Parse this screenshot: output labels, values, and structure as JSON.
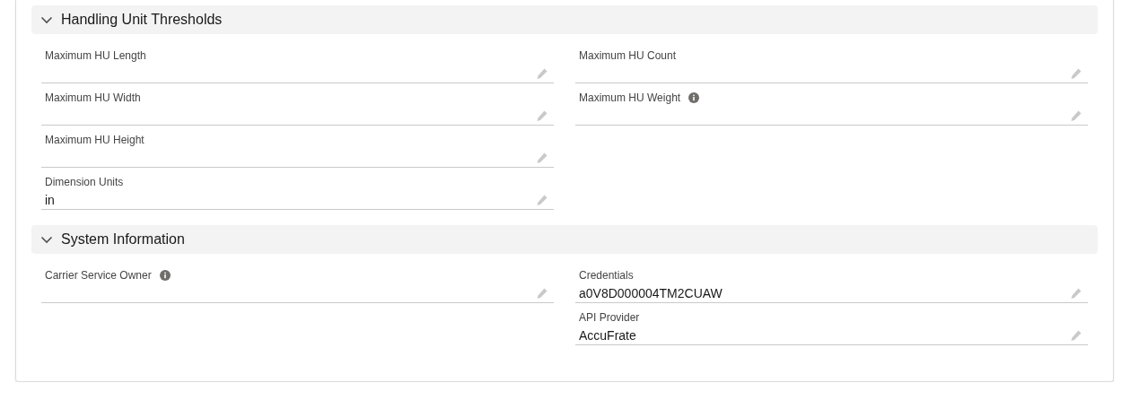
{
  "sections": [
    {
      "title": "Handling Unit Thresholds",
      "expanded": true,
      "left_fields": [
        {
          "label": "Maximum HU Length",
          "info": false,
          "editable": true
        },
        {
          "label": "Maximum HU Width",
          "info": false,
          "editable": true
        },
        {
          "label": "Maximum HU Height",
          "info": false,
          "editable": true
        },
        {
          "label": "Dimension Units",
          "value": "in",
          "info": false,
          "editable": true
        }
      ],
      "right_fields": [
        {
          "label": "Maximum HU Count",
          "info": false,
          "editable": true
        },
        {
          "label": "Maximum HU Weight",
          "info": true,
          "editable": true
        }
      ]
    },
    {
      "title": "System Information",
      "expanded": true,
      "left_fields": [
        {
          "label": "Carrier Service Owner",
          "info": true,
          "editable": true
        }
      ],
      "right_fields": [
        {
          "label": "Credentials",
          "value": "a0V8D000004TM2CUAW",
          "info": false,
          "editable": true
        },
        {
          "label": "API Provider",
          "value": "AccuFrate",
          "info": false,
          "editable": true
        }
      ]
    }
  ]
}
